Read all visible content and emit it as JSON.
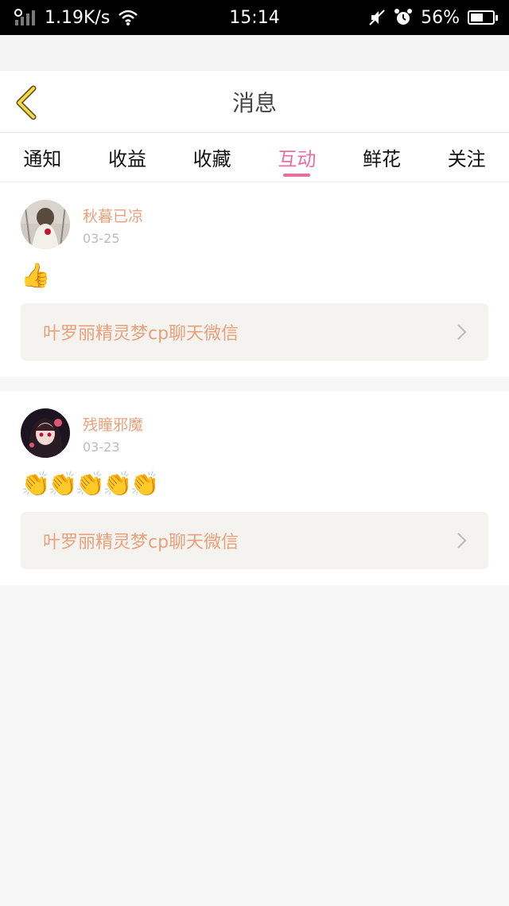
{
  "status": {
    "speed": "1.19K/s",
    "time": "15:14",
    "battery": "56%"
  },
  "nav": {
    "title": "消息"
  },
  "tabs": [
    {
      "label": "通知"
    },
    {
      "label": "收益"
    },
    {
      "label": "收藏"
    },
    {
      "label": "互动",
      "active": true
    },
    {
      "label": "鲜花"
    },
    {
      "label": "关注"
    }
  ],
  "posts": [
    {
      "name": "秋暮已凉",
      "date": "03-25",
      "emojis": "👍",
      "link": "叶罗丽精灵梦cp聊天微信"
    },
    {
      "name": "残瞳邪魔",
      "date": "03-23",
      "emojis": "👏👏👏👏👏",
      "link": "叶罗丽精灵梦cp聊天微信"
    }
  ],
  "colors": {
    "accent": "#e76fa5",
    "name": "#e8a07a",
    "date": "#bbbbbb"
  },
  "icons": [
    "back-icon",
    "chevron-right-icon",
    "signal-icon",
    "wifi-icon",
    "mute-icon",
    "alarm-icon",
    "battery-icon"
  ]
}
